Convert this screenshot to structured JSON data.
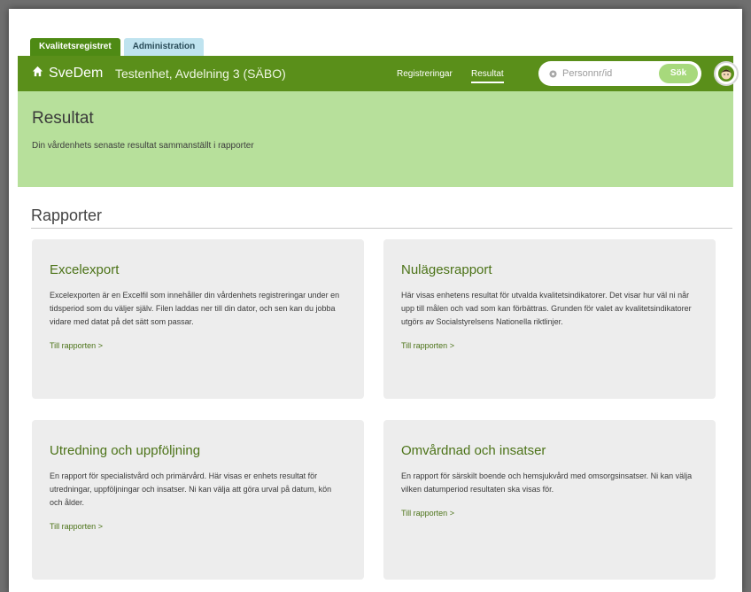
{
  "tabs": [
    {
      "label": "Kvalitetsregistret",
      "active": true
    },
    {
      "label": "Administration",
      "active": false
    }
  ],
  "navbar": {
    "brand_icon": "home-icon",
    "brand": "SveDem",
    "unit": "Testenhet, Avdelning 3 (SÄBO)",
    "links": [
      {
        "label": "Registreringar",
        "active": false
      },
      {
        "label": "Resultat",
        "active": true
      }
    ],
    "search": {
      "icon": "search-icon",
      "placeholder": "Personnr/id",
      "button": "Sök"
    },
    "avatar_icon": "user-avatar-icon"
  },
  "hero": {
    "title": "Resultat",
    "subtitle": "Din vårdenhets senaste resultat sammanställt i rapporter"
  },
  "section": {
    "title": "Rapporter"
  },
  "cards": [
    {
      "title": "Excelexport",
      "text": "Excelexporten är en Excelfil som innehåller din vårdenhets registreringar under en tidsperiod som du väljer själv. Filen laddas ner till din dator, och sen kan du jobba vidare med datat på det sätt som passar.",
      "link": "Till rapporten >"
    },
    {
      "title": "Nulägesrapport",
      "text": "Här visas enhetens resultat för utvalda kvalitetsindikatorer. Det visar hur väl ni når upp till målen och vad som kan förbättras. Grunden för valet av kvalitetsindikatorer utgörs av Socialstyrelsens Nationella riktlinjer.",
      "link": "Till rapporten >"
    },
    {
      "title": "Utredning och uppföljning",
      "text": "En rapport för specialistvård och primärvård. Här visas er enhets resultat för utredningar, uppföljningar och insatser. Ni kan välja att göra urval på datum, kön och ålder.",
      "link": "Till rapporten >"
    },
    {
      "title": "Omvårdnad och insatser",
      "text": "En rapport för särskilt boende och hemsjukvård med omsorgsinsatser. Ni kan välja vilken datumperiod resultaten ska visas för.",
      "link": "Till rapporten >"
    }
  ],
  "colors": {
    "nav_green": "#5a8f1a",
    "hero_green": "#b7e09b",
    "link_green": "#4c7318"
  }
}
